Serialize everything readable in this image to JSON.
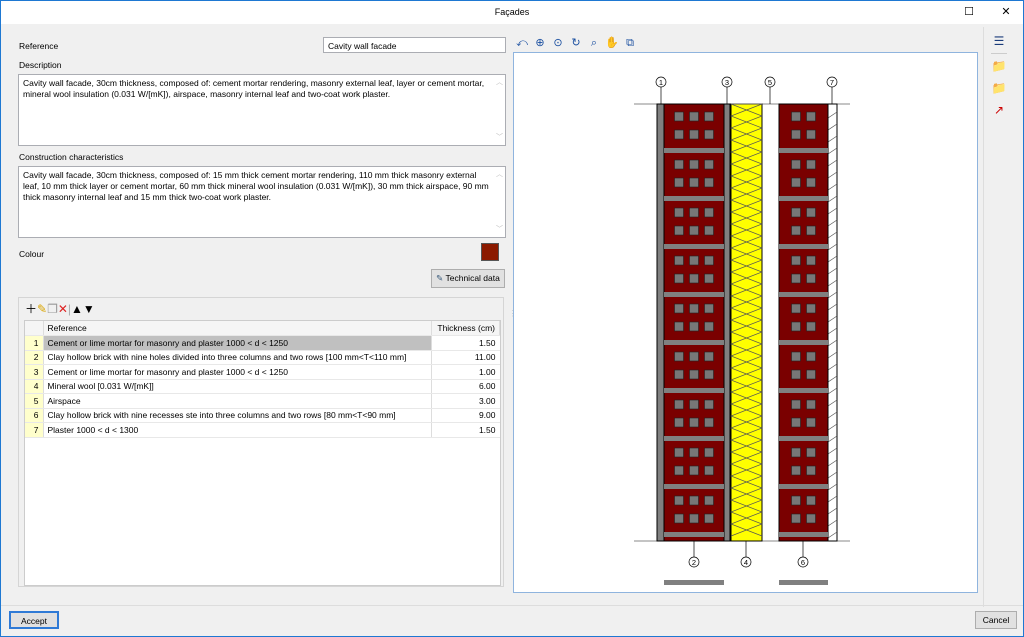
{
  "window": {
    "title": "Façades",
    "maximize_icon": "maximize-icon",
    "close_icon": "close-icon"
  },
  "form": {
    "reference_label": "Reference",
    "reference_value": "Cavity wall facade",
    "description_label": "Description",
    "description_value": "Cavity wall facade, 30cm thickness, composed of: cement mortar rendering,  masonry external leaf, layer or cement mortar, mineral wool insulation (0.031 W/[mK]), airspace, masonry internal leaf and two-coat work plaster.",
    "construction_label": "Construction characteristics",
    "construction_value": "Cavity wall facade, 30cm thickness, composed of: 15 mm thick cement mortar rendering, 110 mm thick masonry external leaf, 10 mm thick  layer or cement mortar, 60 mm thick mineral wool insulation (0.031 W/[mK]), 30 mm thick airspace, 90 mm thick masonry internal leaf and 15 mm thick two-coat work plaster.",
    "colour_label": "Colour",
    "colour_value": "#8b1a00",
    "technical_data_label": "Technical data"
  },
  "layers": {
    "columns": [
      "Reference",
      "Thickness (cm)"
    ],
    "rows": [
      {
        "n": "1",
        "ref": "Cement or lime mortar for masonry and plaster  1000 < d < 1250",
        "t": "1.50"
      },
      {
        "n": "2",
        "ref": "Clay hollow brick with nine holes divided into three columns and two rows [100 mm<T<110 mm]",
        "t": "11.00"
      },
      {
        "n": "3",
        "ref": "Cement or lime mortar for masonry and plaster  1000 < d < 1250",
        "t": "1.00"
      },
      {
        "n": "4",
        "ref": "Mineral wool [0.031 W/[mK]]",
        "t": "6.00"
      },
      {
        "n": "5",
        "ref": "Airspace",
        "t": "3.00"
      },
      {
        "n": "6",
        "ref": "Clay hollow brick with nine recesses ste into three columns and two rows [80 mm<T<90 mm]",
        "t": "9.00"
      },
      {
        "n": "7",
        "ref": "Plaster 1000 < d < 1300",
        "t": "1.50"
      }
    ],
    "selected_row": 1
  },
  "drawing": {
    "labels_top": [
      "1",
      "3",
      "5",
      "7"
    ],
    "labels_bottom": [
      "2",
      "4",
      "6"
    ],
    "brick_color": "#7a0000",
    "wool_color": "#ffff00",
    "mortar_color": "#808080"
  },
  "footer": {
    "accept": "Accept",
    "cancel": "Cancel"
  }
}
